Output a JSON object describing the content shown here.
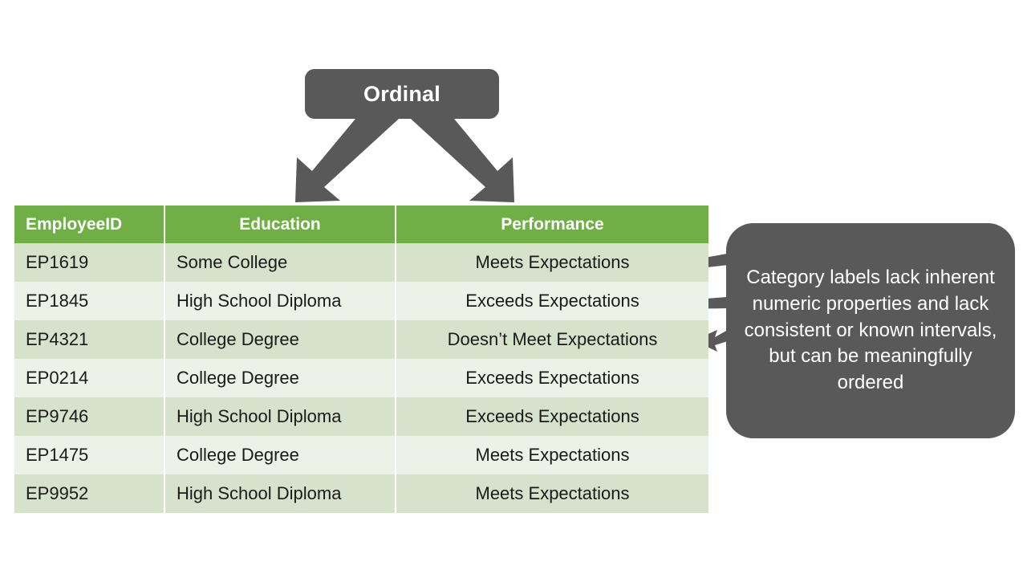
{
  "ordinal_callout": {
    "label": "Ordinal",
    "box_color": "#595959",
    "text_color": "#ffffff"
  },
  "arrows": {
    "down_left_arrow": "arrow-down-left-icon",
    "down_right_arrow": "arrow-down-right-icon",
    "note_arrow_1": "arrow-left-icon",
    "note_arrow_2": "arrow-left-icon",
    "note_arrow_3": "arrow-left-icon",
    "color": "#595959"
  },
  "table": {
    "header_color": "#6FAF46",
    "row_color_a": "#D6E2CB",
    "row_color_b": "#EDF2E8",
    "columns": [
      "EmployeeID",
      "Education",
      "Performance"
    ],
    "rows": [
      [
        "EP1619",
        "Some College",
        "Meets Expectations"
      ],
      [
        "EP1845",
        "High School Diploma",
        "Exceeds Expectations"
      ],
      [
        "EP4321",
        "College Degree",
        "Doesn’t Meet Expectations"
      ],
      [
        "EP0214",
        "College Degree",
        "Exceeds Expectations"
      ],
      [
        "EP9746",
        "High School Diploma",
        "Exceeds Expectations"
      ],
      [
        "EP1475",
        "College Degree",
        "Meets Expectations"
      ],
      [
        "EP9952",
        "High School Diploma",
        "Meets Expectations"
      ]
    ]
  },
  "note_callout": {
    "text": "Category labels lack inherent numeric properties and lack consistent or known intervals, but can be meaningfully ordered",
    "box_color": "#595959",
    "text_color": "#ffffff"
  }
}
